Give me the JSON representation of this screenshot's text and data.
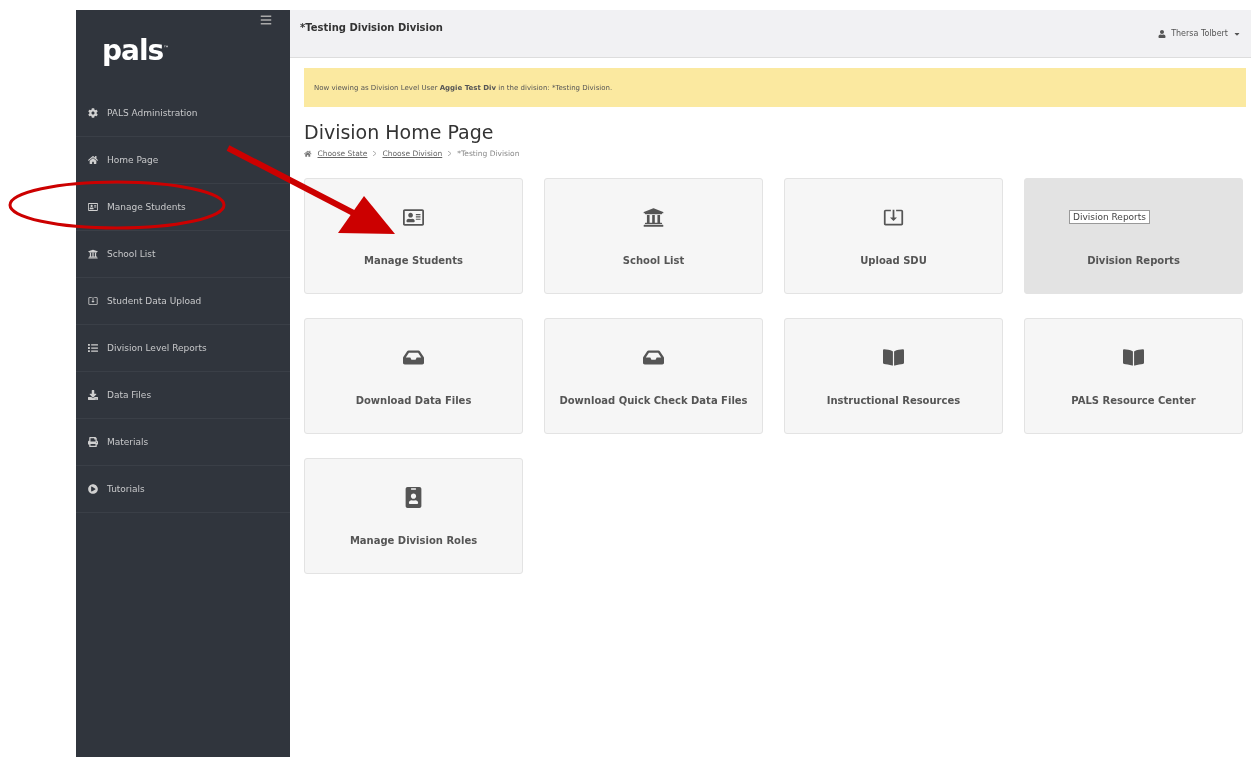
{
  "sidebar": {
    "logo": "pals",
    "logo_mark": "™",
    "items": [
      {
        "label": "PALS Administration"
      },
      {
        "label": "Home Page"
      },
      {
        "label": "Manage Students"
      },
      {
        "label": "School List"
      },
      {
        "label": "Student Data Upload"
      },
      {
        "label": "Division Level Reports"
      },
      {
        "label": "Data Files"
      },
      {
        "label": "Materials"
      },
      {
        "label": "Tutorials"
      }
    ]
  },
  "header": {
    "title": "*Testing Division Division",
    "user": "Thersa Tolbert"
  },
  "alert": {
    "text": "Now viewing as Division Level User **Aggie Test Div** in the division: *Testing Division."
  },
  "page_title": "Division Home Page",
  "breadcrumb": [
    {
      "label": "Choose State",
      "link": true
    },
    {
      "label": "Choose Division",
      "link": true
    },
    {
      "label": "*Testing Division",
      "link": false
    }
  ],
  "cards": [
    {
      "label": "Manage Students",
      "hovered": false
    },
    {
      "label": "School List",
      "hovered": false
    },
    {
      "label": "Upload SDU",
      "hovered": false
    },
    {
      "label": "Division Reports",
      "hovered": true,
      "tooltip": "Division Reports"
    },
    {
      "label": "Download Data Files",
      "hovered": false
    },
    {
      "label": "Download Quick Check Data Files",
      "hovered": false
    },
    {
      "label": "Instructional Resources",
      "hovered": false
    },
    {
      "label": "PALS Resource Center",
      "hovered": false
    },
    {
      "label": "Manage Division Roles",
      "hovered": false
    }
  ]
}
